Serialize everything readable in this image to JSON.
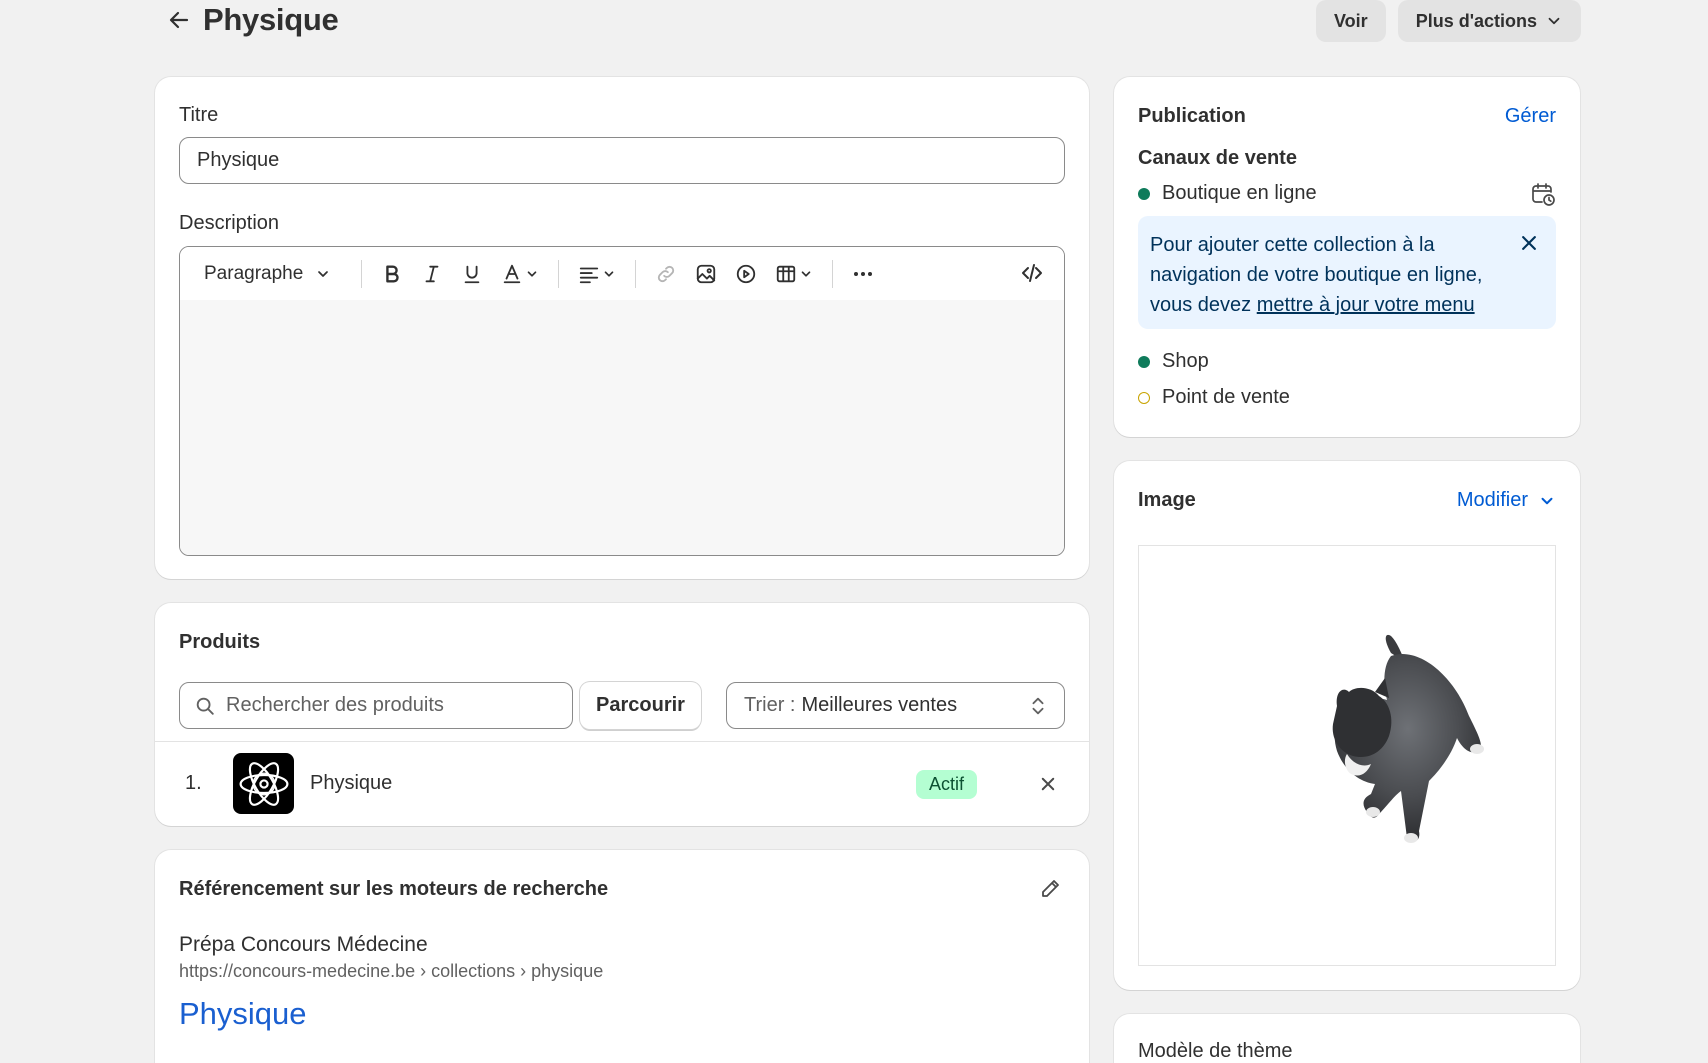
{
  "header": {
    "title": "Physique",
    "view_label": "Voir",
    "more_actions_label": "Plus d'actions"
  },
  "main_card": {
    "title_label": "Titre",
    "title_value": "Physique",
    "description_label": "Description",
    "toolbar": {
      "paragraph_label": "Paragraphe"
    }
  },
  "products": {
    "heading": "Produits",
    "search_placeholder": "Rechercher des produits",
    "browse_label": "Parcourir",
    "sort_prefix": "Trier :",
    "sort_value": "Meilleures ventes",
    "items": [
      {
        "index": "1.",
        "name": "Physique",
        "status": "Actif"
      }
    ]
  },
  "seo": {
    "heading": "Référencement sur les moteurs de recherche",
    "store_name": "Prépa Concours Médecine",
    "url": "https://concours-medecine.be › collections › physique",
    "page_title": "Physique"
  },
  "publication": {
    "heading": "Publication",
    "manage_label": "Gérer",
    "channels_heading": "Canaux de vente",
    "channels": [
      {
        "name": "Boutique en ligne",
        "active": true
      },
      {
        "name": "Shop",
        "active": true
      },
      {
        "name": "Point de vente",
        "active": false
      }
    ],
    "banner_text": "Pour ajouter cette collection à la navigation de votre boutique en ligne, vous devez ",
    "banner_link": "mettre à jour votre menu"
  },
  "image": {
    "heading": "Image",
    "edit_label": "Modifier"
  },
  "theme": {
    "heading": "Modèle de thème"
  },
  "colors": {
    "accent_blue": "#005bd3",
    "active_green": "#0f7b5b",
    "badge_bg": "#b4fed2",
    "banner_bg": "#eaf4ff"
  }
}
